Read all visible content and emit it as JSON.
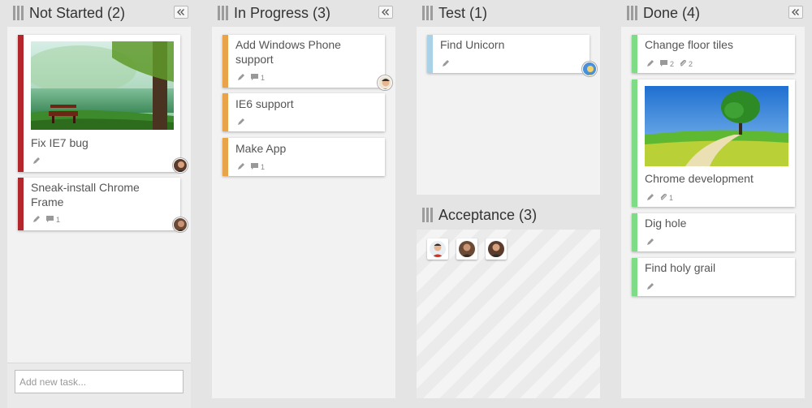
{
  "colors": {
    "not_started": "#b3262b",
    "in_progress": "#e9a44a",
    "test": "#a9d2e6",
    "done": "#7fdc86"
  },
  "icons": [
    "column-grip-icon",
    "collapse-icon",
    "pencil-icon",
    "comment-icon",
    "attachment-icon",
    "avatar-icon"
  ],
  "columns": {
    "not_started": {
      "title": "Not Started (2)",
      "cards": [
        {
          "title": "Fix IE7 bug"
        },
        {
          "title": "Sneak-install Chrome Frame",
          "comments": "1"
        }
      ],
      "add_placeholder": "Add new task..."
    },
    "in_progress": {
      "title": "In Progress (3)",
      "cards": [
        {
          "title": "Add Windows Phone support",
          "comments": "1"
        },
        {
          "title": "IE6 support"
        },
        {
          "title": "Make App",
          "comments": "1"
        }
      ]
    },
    "test": {
      "title": "Test (1)",
      "cards": [
        {
          "title": "Find Unicorn"
        }
      ]
    },
    "acceptance": {
      "title": "Acceptance (3)"
    },
    "done": {
      "title": "Done (4)",
      "cards": [
        {
          "title": "Change floor tiles",
          "comments": "2",
          "attachments": "2"
        },
        {
          "title": "Chrome development",
          "attachments": "1"
        },
        {
          "title": "Dig hole"
        },
        {
          "title": "Find holy grail"
        }
      ]
    }
  }
}
